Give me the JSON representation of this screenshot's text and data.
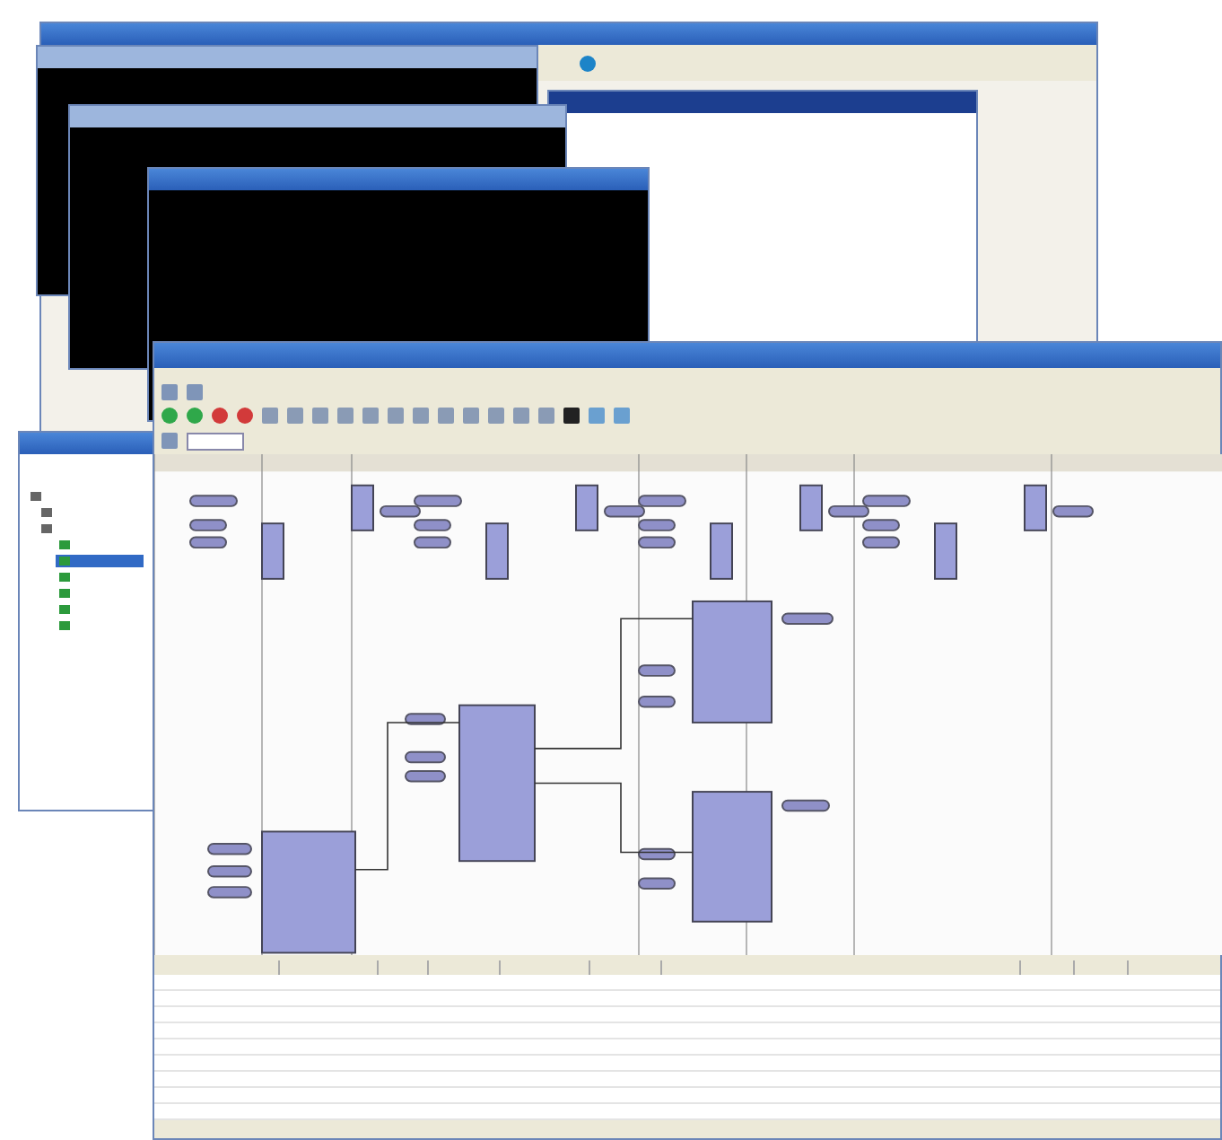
{
  "console_windows": [
    {
      "active": false
    },
    {
      "active": false
    },
    {
      "active": true
    }
  ],
  "tree": {
    "items": [
      {
        "kind": "root",
        "selected": false
      },
      {
        "kind": "folder",
        "selected": false
      },
      {
        "kind": "folder",
        "selected": false
      },
      {
        "kind": "node",
        "selected": false
      },
      {
        "kind": "node",
        "selected": true
      },
      {
        "kind": "node",
        "selected": false
      },
      {
        "kind": "node",
        "selected": false
      },
      {
        "kind": "node",
        "selected": false
      },
      {
        "kind": "node",
        "selected": false
      }
    ]
  },
  "toolbar": {
    "buttons": [
      {
        "kind": "run"
      },
      {
        "kind": "run"
      },
      {
        "kind": "stop"
      },
      {
        "kind": "stop"
      },
      {
        "kind": "tool"
      },
      {
        "kind": "tool"
      },
      {
        "kind": "tool"
      },
      {
        "kind": "tool"
      },
      {
        "kind": "tool"
      },
      {
        "kind": "tool"
      },
      {
        "kind": "tool"
      },
      {
        "kind": "tool"
      },
      {
        "kind": "tool"
      },
      {
        "kind": "tool"
      },
      {
        "kind": "tool"
      },
      {
        "kind": "tool"
      },
      {
        "kind": "battery"
      },
      {
        "kind": "panel"
      },
      {
        "kind": "panel"
      }
    ]
  },
  "table": {
    "rows": [
      {
        "selected": false
      },
      {
        "selected": false
      },
      {
        "selected": false
      },
      {
        "selected": false
      },
      {
        "selected": false
      },
      {
        "selected": false
      },
      {
        "selected": false
      },
      {
        "selected": false
      },
      {
        "selected": false
      }
    ]
  }
}
